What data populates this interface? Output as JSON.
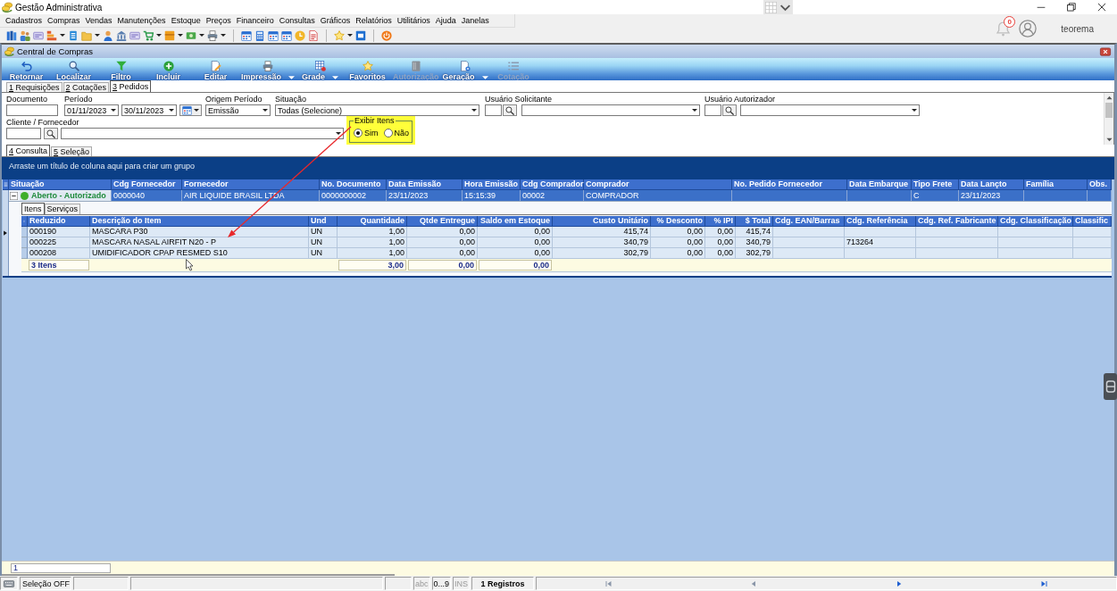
{
  "app": {
    "title": "Gestão Administrativa",
    "notifications": "0",
    "user": "teorema"
  },
  "menu": [
    "Cadastros",
    "Compras",
    "Vendas",
    "Manutenções",
    "Estoque",
    "Preços",
    "Financeiro",
    "Consultas",
    "Gráficos",
    "Relatórios",
    "Utilitários",
    "Ajuda",
    "Janelas"
  ],
  "window": {
    "title": "Central de Compras"
  },
  "actions": [
    {
      "label": "Retornar",
      "disabled": false,
      "dropdown": false
    },
    {
      "label": "Localizar",
      "disabled": false,
      "dropdown": false
    },
    {
      "label": "Filtro",
      "disabled": false,
      "dropdown": false
    },
    {
      "label": "Incluir",
      "disabled": false,
      "dropdown": false
    },
    {
      "label": "Editar",
      "disabled": false,
      "dropdown": false
    },
    {
      "label": "Impressão",
      "disabled": false,
      "dropdown": true
    },
    {
      "label": "Grade",
      "disabled": false,
      "dropdown": true
    },
    {
      "label": "Favoritos",
      "disabled": false,
      "dropdown": false
    },
    {
      "label": "Autorização",
      "disabled": true,
      "dropdown": false
    },
    {
      "label": "Geração",
      "disabled": false,
      "dropdown": true
    },
    {
      "label": "Cotação",
      "disabled": true,
      "dropdown": false
    }
  ],
  "tabs": [
    {
      "label": "1 Requisições",
      "selected": false
    },
    {
      "label": "2 Cotações",
      "selected": false
    },
    {
      "label": "3 Pedidos",
      "selected": true
    }
  ],
  "filters": {
    "documento": {
      "label": "Documento"
    },
    "periodo": {
      "label": "Período",
      "from": "01/11/2023",
      "to": "30/11/2023"
    },
    "origem_periodo": {
      "label": "Origem Período",
      "value": "Emissão"
    },
    "situacao": {
      "label": "Situação",
      "value": "Todas (Selecione)"
    },
    "usuario_solicitante": {
      "label": "Usuário Solicitante"
    },
    "usuario_autorizador": {
      "label": "Usuário Autorizador"
    },
    "cliente_fornecedor": {
      "label": "Cliente / Fornecedor"
    },
    "exibir_itens": {
      "label": "Exibir Itens",
      "highlighted": true,
      "options": [
        {
          "label": "Sim",
          "selected": true
        },
        {
          "label": "Não",
          "selected": false
        }
      ]
    }
  },
  "view_tabs": [
    {
      "label": "4 Consulta",
      "selected": true
    },
    {
      "label": "5 Seleção",
      "selected": false
    }
  ],
  "grid": {
    "group_hint": "Arraste um título de coluna aqui para criar um grupo",
    "columns": [
      "Situação",
      "Cdg Fornecedor",
      "Fornecedor",
      "No. Documento",
      "Data Emissão",
      "Hora Emissão",
      "Cdg Comprador",
      "Comprador",
      "No. Pedido Fornecedor",
      "Data Embarque",
      "Tipo Frete",
      "Data Lançto",
      "Família",
      "Obs."
    ],
    "rows": [
      {
        "selected": true,
        "expanded": true,
        "color": "#3fae2a",
        "cells": [
          "Aberto - Autorizado",
          "0000040",
          "AIR LIQUIDE BRASIL LTDA",
          "0000000002",
          "23/11/2023",
          "15:15:39",
          "00002",
          "COMPRADOR",
          "",
          "",
          "C",
          "23/11/2023",
          "",
          ""
        ],
        "detail": {
          "tabs": [
            {
              "label": "Itens",
              "selected": true
            },
            {
              "label": "Serviços",
              "selected": false
            }
          ],
          "columns": [
            {
              "label": "Reduzido",
              "kind": "text",
              "summary": "3 Itens"
            },
            {
              "label": "Descrição do Item",
              "kind": "text"
            },
            {
              "label": "Und",
              "kind": "text"
            },
            {
              "label": "Quantidade",
              "kind": "number",
              "summary": "3,00"
            },
            {
              "label": "Qtde Entregue",
              "kind": "number",
              "summary": "0,00"
            },
            {
              "label": "Saldo em Estoque",
              "kind": "number",
              "summary": "0,00"
            },
            {
              "label": "Custo Unitário",
              "kind": "number"
            },
            {
              "label": "% Desconto",
              "kind": "number"
            },
            {
              "label": "% IPI",
              "kind": "number"
            },
            {
              "label": "$ Total",
              "kind": "number"
            },
            {
              "label": "Cdg. EAN/Barras",
              "kind": "text"
            },
            {
              "label": "Cdg. Referência",
              "kind": "text"
            },
            {
              "label": "Cdg. Ref. Fabricante",
              "kind": "text"
            },
            {
              "label": "Cdg. Classificação",
              "kind": "text"
            },
            {
              "label": "Classific",
              "kind": "text"
            }
          ],
          "rows": [
            [
              "000190",
              "MASCARA P30",
              "UN",
              "1,00",
              "0,00",
              "0,00",
              "415,74",
              "0,00",
              "0,00",
              "415,74",
              "",
              "",
              "",
              "",
              ""
            ],
            [
              "000225",
              "MASCARA NASAL AIRFIT N20 - P",
              "UN",
              "1,00",
              "0,00",
              "0,00",
              "340,79",
              "0,00",
              "0,00",
              "340,79",
              "",
              "713264",
              "",
              "",
              ""
            ],
            [
              "000208",
              "UMIDIFICADOR CPAP RESMED S10",
              "UN",
              "1,00",
              "0,00",
              "0,00",
              "302,79",
              "0,00",
              "0,00",
              "302,79",
              "",
              "",
              "",
              "",
              ""
            ]
          ]
        }
      }
    ]
  },
  "record_field": {
    "value": "1"
  },
  "status_bar": {
    "selection": "Seleção OFF",
    "indicators": [
      {
        "label": "abc",
        "on": false
      },
      {
        "label": "0...9",
        "on": true
      },
      {
        "label": "INS",
        "on": false
      }
    ],
    "records": "1 Registros",
    "navigation": [
      {
        "kind": "first",
        "disabled": true
      },
      {
        "kind": "previous",
        "disabled": true
      },
      {
        "kind": "next",
        "disabled": false
      },
      {
        "kind": "last",
        "disabled": false
      }
    ]
  }
}
